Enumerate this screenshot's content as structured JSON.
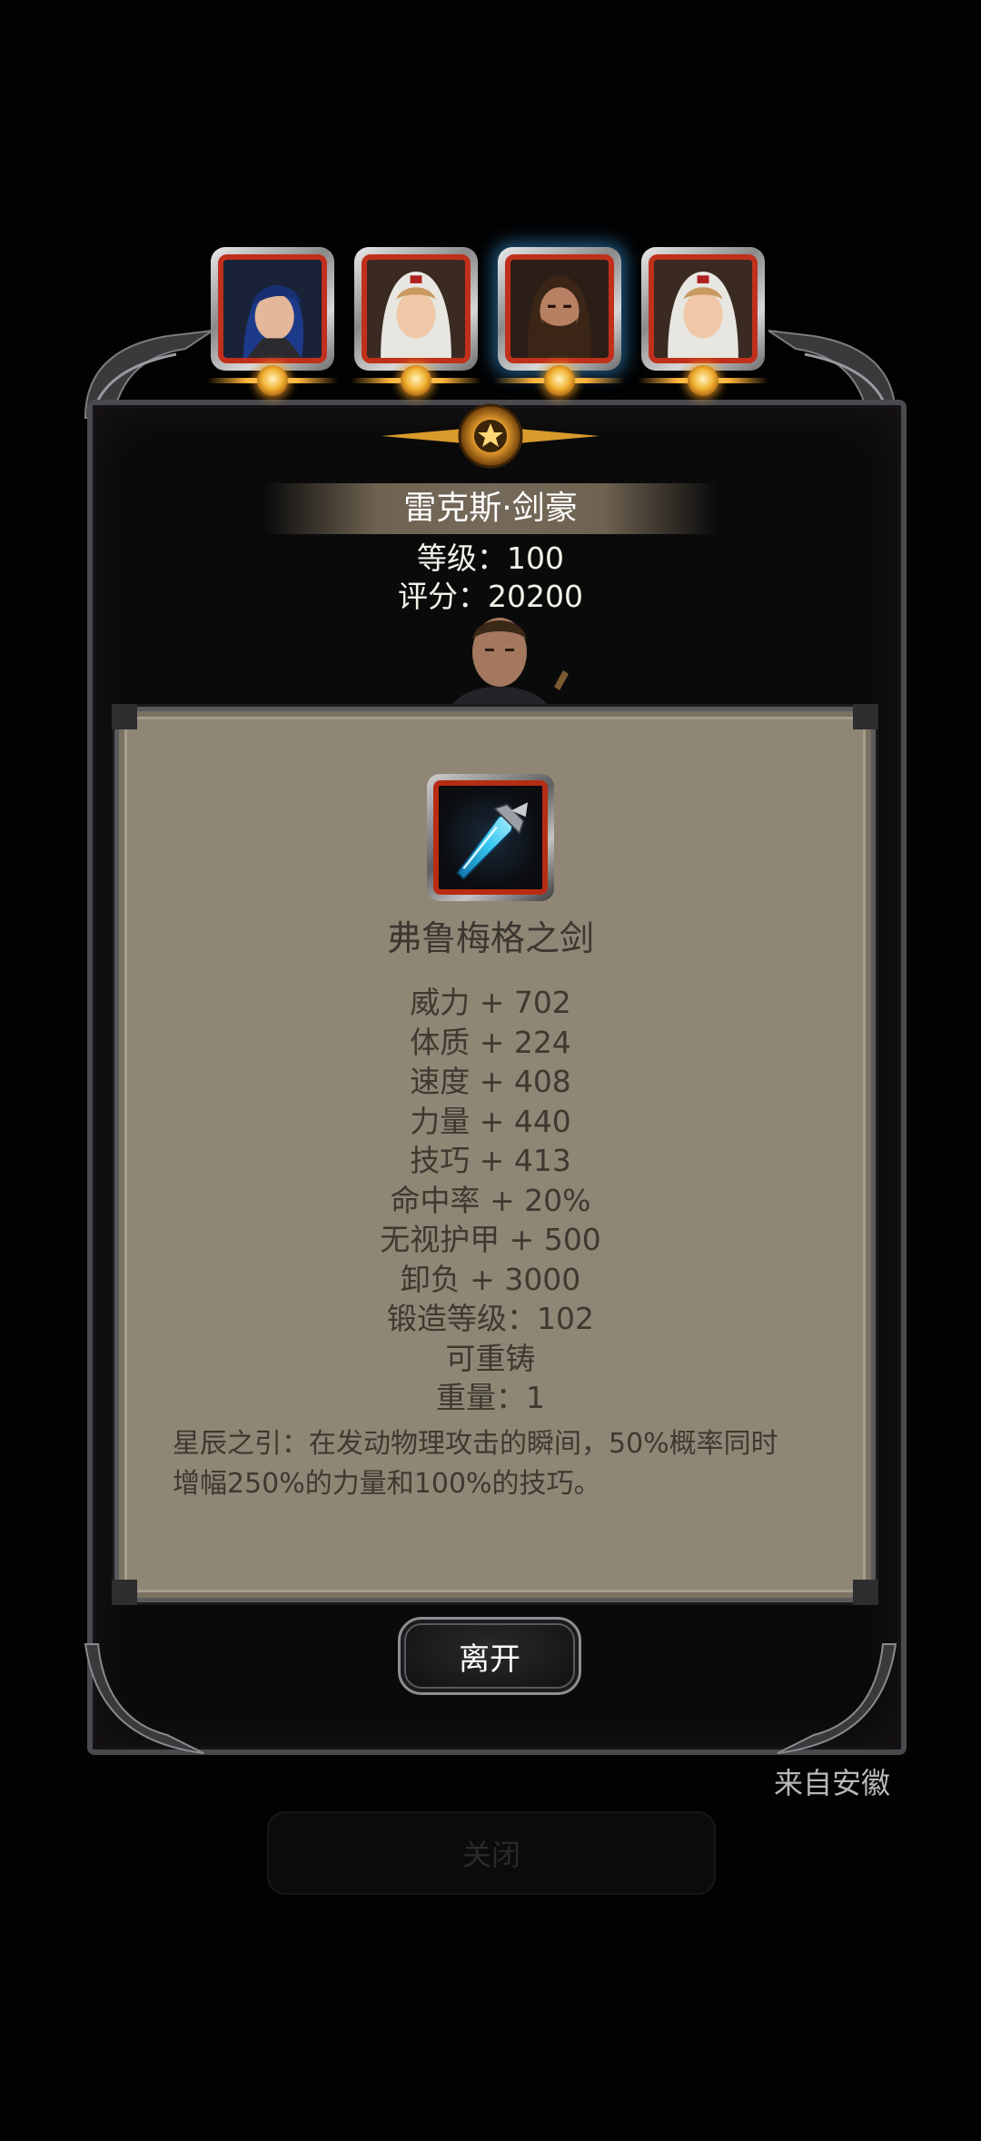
{
  "heroes": [
    {
      "name": "hero-1",
      "icon": "blue-hair-hero-portrait",
      "active": false
    },
    {
      "name": "hero-2",
      "icon": "nun-hero-portrait",
      "active": false
    },
    {
      "name": "hero-3",
      "icon": "bearded-hero-portrait",
      "active": true
    },
    {
      "name": "hero-4",
      "icon": "nun-hero-portrait",
      "active": false
    }
  ],
  "hero": {
    "name": "雷克斯·剑豪",
    "level_text": "等级：100",
    "score_text": "评分：20200"
  },
  "item": {
    "icon": "crystal-sword-icon",
    "name": "弗鲁梅格之剑",
    "stats": [
      "威力 + 702",
      "体质 + 224",
      "速度 + 408",
      "力量 + 440",
      "技巧 + 413",
      "命中率 + 20%",
      "无视护甲 + 500",
      "卸负 + 3000",
      "锻造等级：102",
      "可重铸",
      "重量：1"
    ],
    "description_line1": "星辰之引：在发动物理攻击的瞬间，50%概率同时",
    "description_line2": "增幅250%的力量和100%的技巧。"
  },
  "buttons": {
    "leave": "离开",
    "close": "关闭"
  },
  "source_label": "来自安徽",
  "colors": {
    "card_bg": "#8f8676",
    "frame_red": "#c0301c",
    "gold": "#ffb23a",
    "panel_bg": "#0a0a0b"
  }
}
